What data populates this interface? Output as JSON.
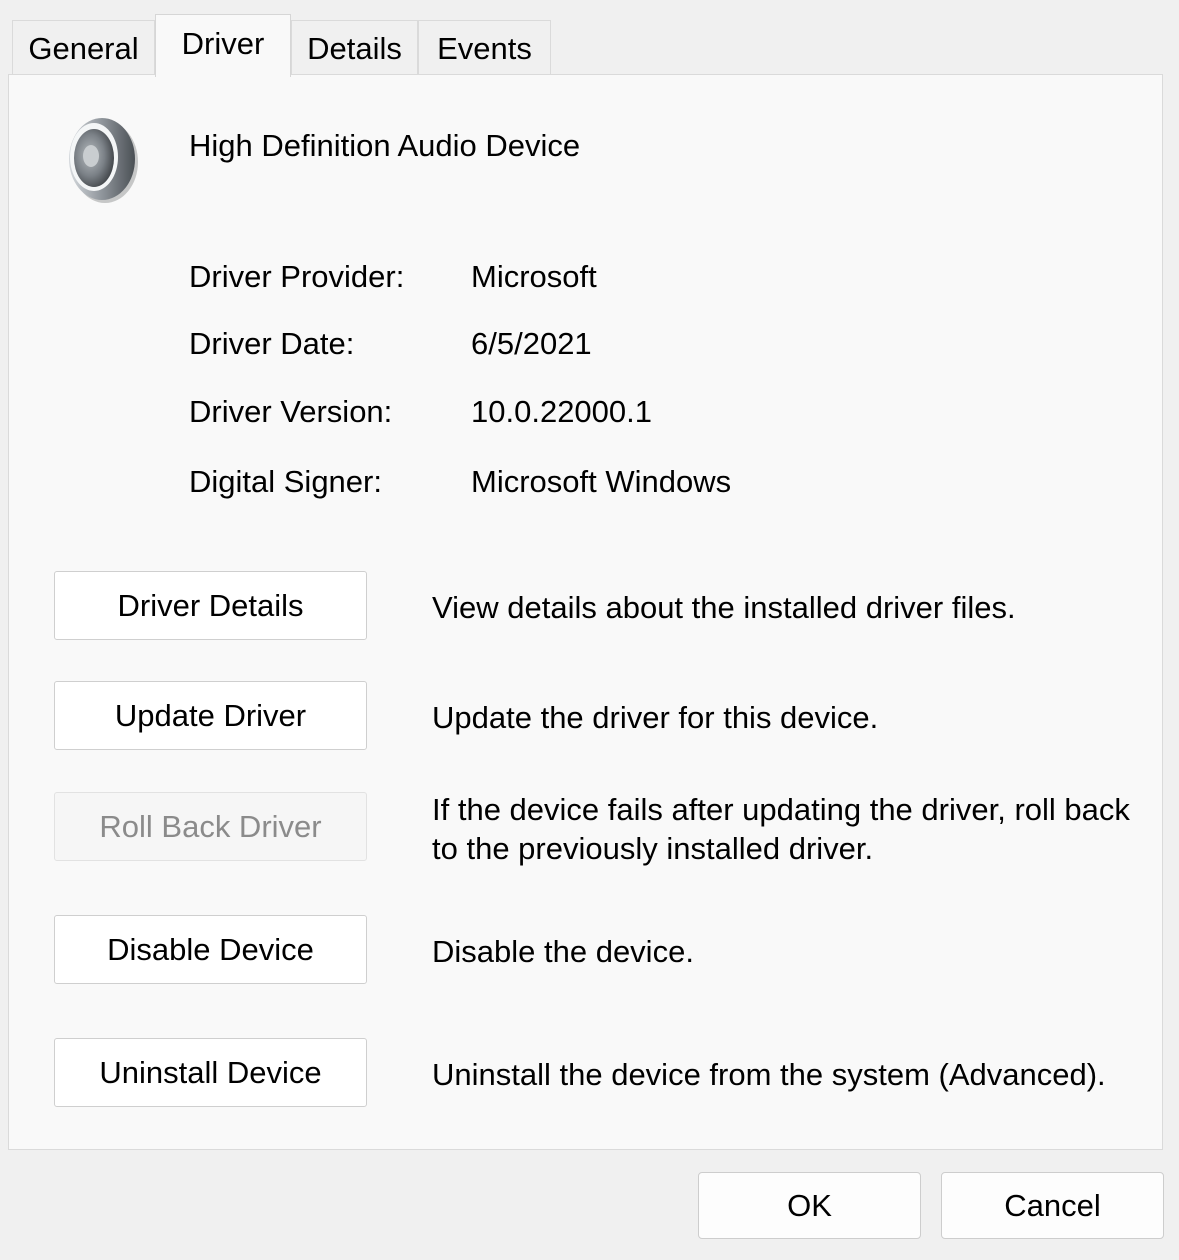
{
  "tabs": [
    {
      "label": "General"
    },
    {
      "label": "Driver"
    },
    {
      "label": "Details"
    },
    {
      "label": "Events"
    }
  ],
  "device": {
    "name": "High Definition Audio Device",
    "icon": "speaker-icon"
  },
  "properties": [
    {
      "label": "Driver Provider:",
      "value": "Microsoft"
    },
    {
      "label": "Driver Date:",
      "value": "6/5/2021"
    },
    {
      "label": "Driver Version:",
      "value": "10.0.22000.1"
    },
    {
      "label": "Digital Signer:",
      "value": "Microsoft Windows"
    }
  ],
  "actions": [
    {
      "label": "Driver Details",
      "description": "View details about the installed driver files.",
      "enabled": true
    },
    {
      "label": "Update Driver",
      "description": "Update the driver for this device.",
      "enabled": true
    },
    {
      "label": "Roll Back Driver",
      "description": "If the device fails after updating the driver, roll back to the previously installed driver.",
      "enabled": false
    },
    {
      "label": "Disable Device",
      "description": "Disable the device.",
      "enabled": true
    },
    {
      "label": "Uninstall Device",
      "description": "Uninstall the device from the system (Advanced).",
      "enabled": true
    }
  ],
  "footer": {
    "ok_label": "OK",
    "cancel_label": "Cancel"
  }
}
